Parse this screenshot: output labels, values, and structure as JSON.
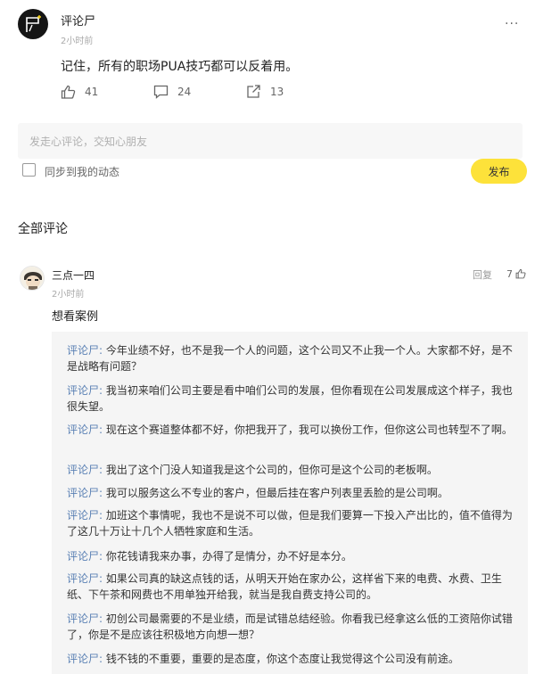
{
  "post": {
    "author": "评论尸",
    "time": "2小时前",
    "more_icon": "···",
    "text": "记住，所有的职场PUA技巧都可以反着用。",
    "likes": "41",
    "comments": "24",
    "shares": "13"
  },
  "compose": {
    "placeholder": "发走心评论，交知心朋友",
    "sync_label": "同步到我的动态",
    "publish_label": "发布"
  },
  "comments_section": {
    "title": "全部评论"
  },
  "comment": {
    "author": "三点一四",
    "time": "2小时前",
    "reply_label": "回复",
    "likes": "7",
    "text": "想看案例"
  },
  "replies": [
    {
      "author": "评论尸",
      "sep": ": ",
      "text": "今年业绩不好，也不是我一个人的问题，这个公司又不止我一个人。大家都不好，是不是战略有问题？"
    },
    {
      "author": "评论尸",
      "sep": ": ",
      "text": "我当初来咱们公司主要是看中咱们公司的发展，但你看现在公司发展成这个样子，我也很失望。"
    },
    {
      "author": "评论尸",
      "sep": ": ",
      "text": "现在这个赛道整体都不好，你把我开了，我可以换份工作，但你这公司也转型不了啊。"
    },
    {
      "author": "评论尸",
      "sep": ": ",
      "text": "我出了这个门没人知道我是这个公司的，但你可是这个公司的老板啊。"
    },
    {
      "author": "评论尸",
      "sep": ": ",
      "text": "我可以服务这么不专业的客户，但最后挂在客户列表里丢脸的是公司啊。"
    },
    {
      "author": "评论尸",
      "sep": ": ",
      "text": "加班这个事情呢，我也不是说不可以做，但是我们要算一下投入产出比的，值不值得为了这几十万让十几个人牺牲家庭和生活。"
    },
    {
      "author": "评论尸",
      "sep": ": ",
      "text": "你花钱请我来办事，办得了是情分，办不好是本分。"
    },
    {
      "author": "评论尸",
      "sep": ": ",
      "text": "如果公司真的缺这点钱的话，从明天开始在家办公，这样省下来的电费、水费、卫生纸、下午茶和网费也不用单独开给我，就当是我自费支持公司的。"
    },
    {
      "author": "评论尸",
      "sep": ": ",
      "text": "初创公司最需要的不是业绩，而是试错总结经验。你看我已经拿这么低的工资陪你试错了，你是不是应该往积极地方向想一想？"
    },
    {
      "author": "评论尸",
      "sep": ": ",
      "text": "钱不钱的不重要，重要的是态度，你这个态度让我觉得这个公司没有前途。"
    }
  ]
}
